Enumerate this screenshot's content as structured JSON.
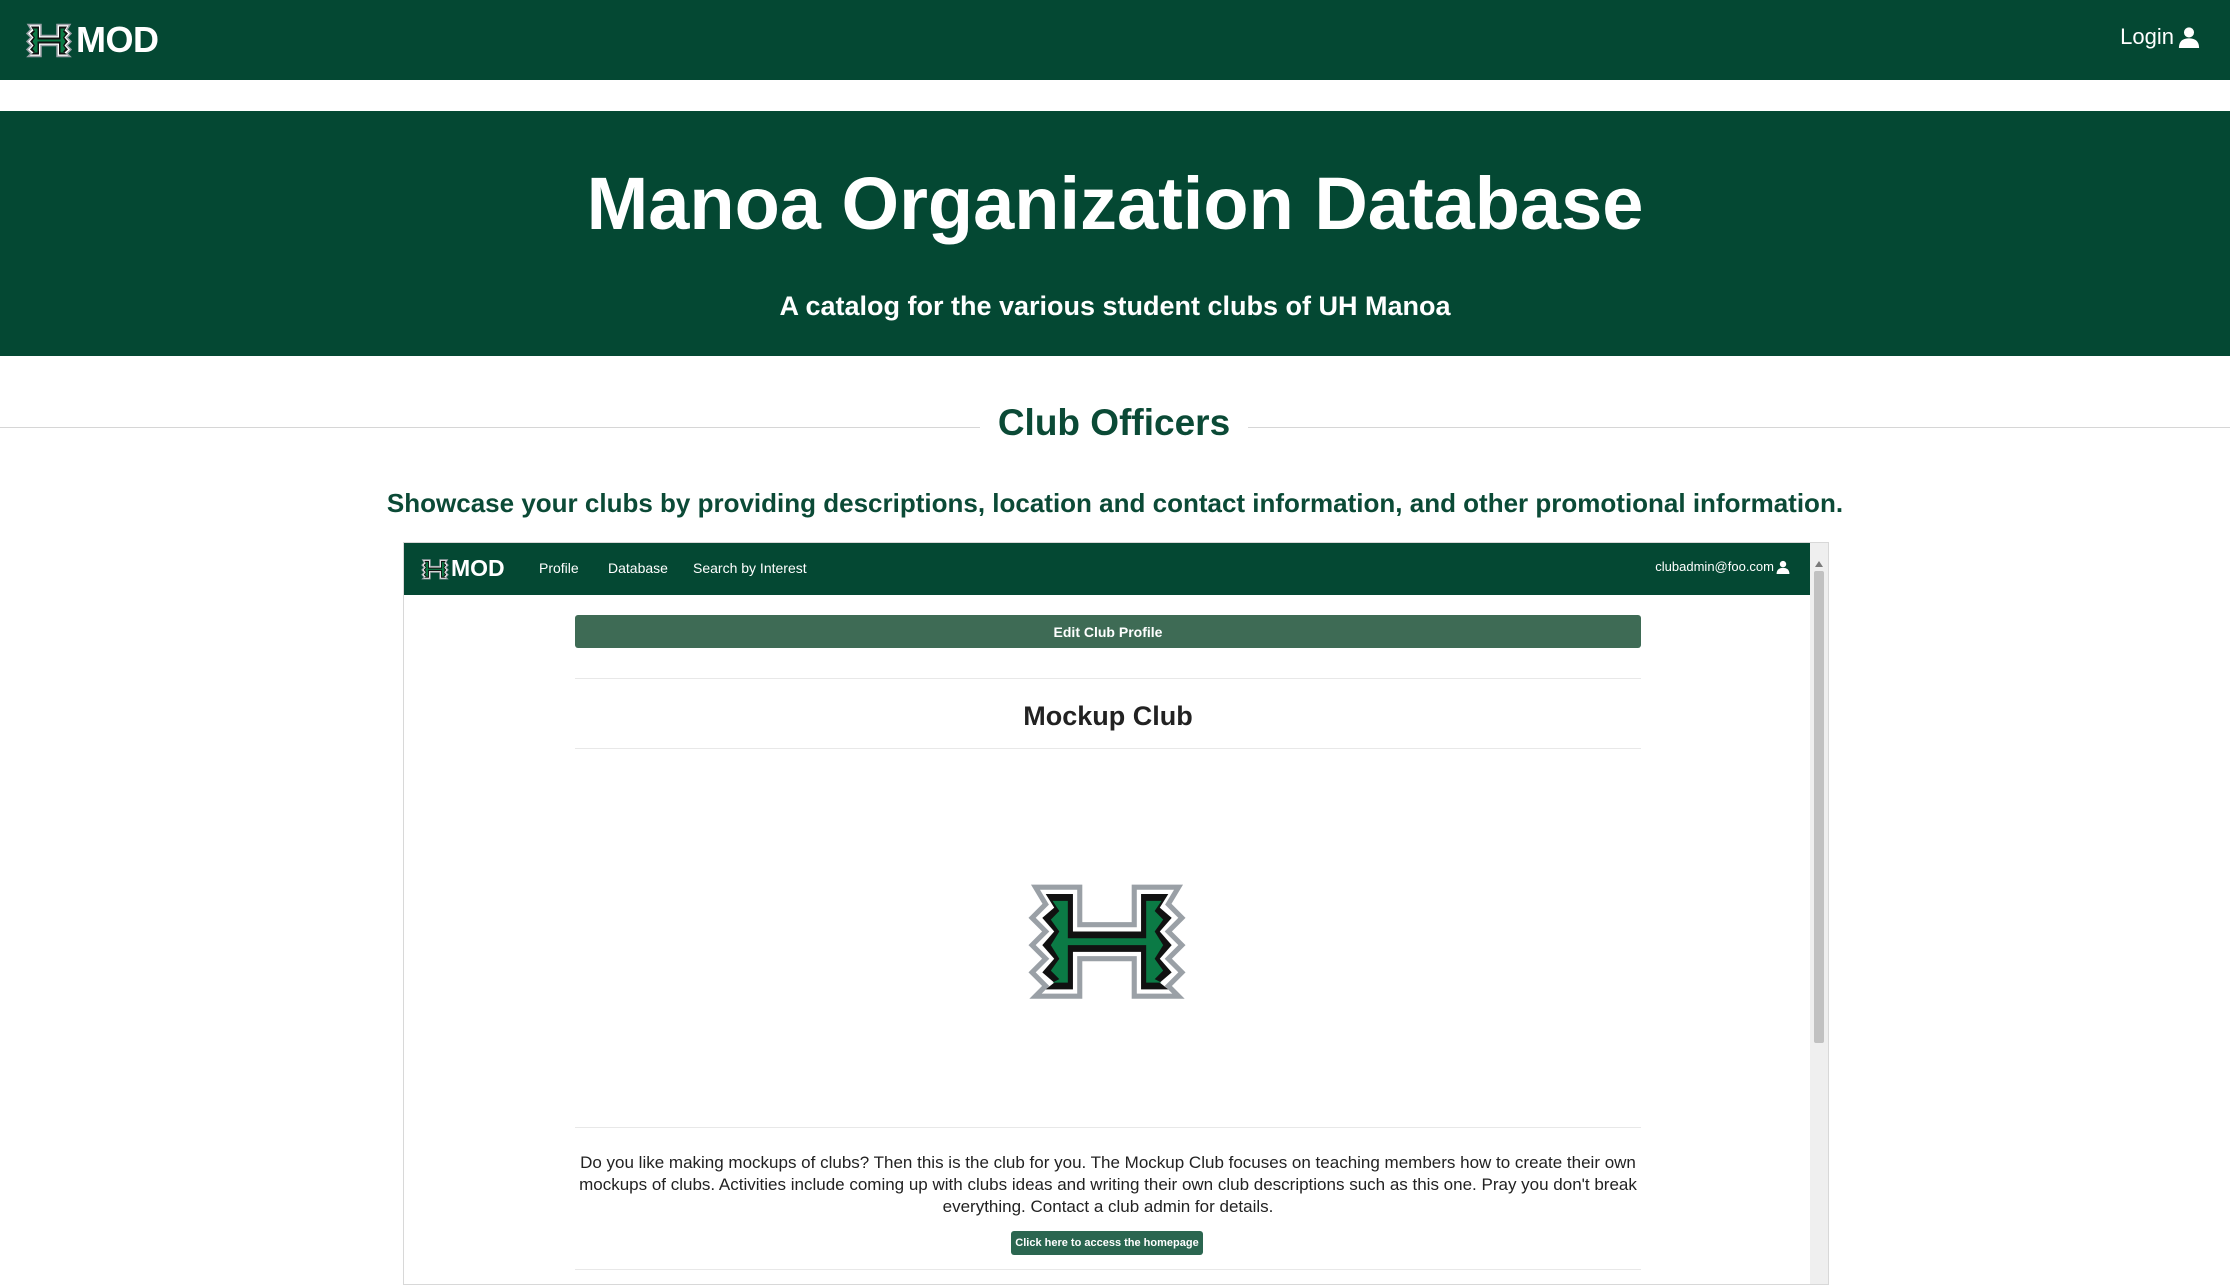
{
  "navbar": {
    "brand": "MOD",
    "login_label": "Login",
    "logo_icon": "h-logo-icon",
    "user_icon": "user-icon"
  },
  "hero": {
    "title": "Manoa Organization Database",
    "subtitle": "A catalog for the various student clubs of UH Manoa"
  },
  "section": {
    "title": "Club Officers",
    "description": "Showcase your clubs by providing descriptions, location and contact information, and other promotional information."
  },
  "screenshot": {
    "navbar": {
      "brand": "MOD",
      "links": [
        "Profile",
        "Database",
        "Search by Interest"
      ],
      "user": "clubadmin@foo.com"
    },
    "edit_button": "Edit Club Profile",
    "club_name": "Mockup Club",
    "club_description": "Do you like making mockups of clubs? Then this is the club for you. The Mockup Club focuses on teaching members how to create their own mockups of clubs. Activities include coming up with clubs ideas and writing their own club descriptions such as this one. Pray you don't break everything. Contact a club admin for details.",
    "home_button": "Click here to access the homepage"
  },
  "colors": {
    "primary_green": "#044833",
    "heading_green": "#0b4a36",
    "button_green": "#3e6b55"
  }
}
